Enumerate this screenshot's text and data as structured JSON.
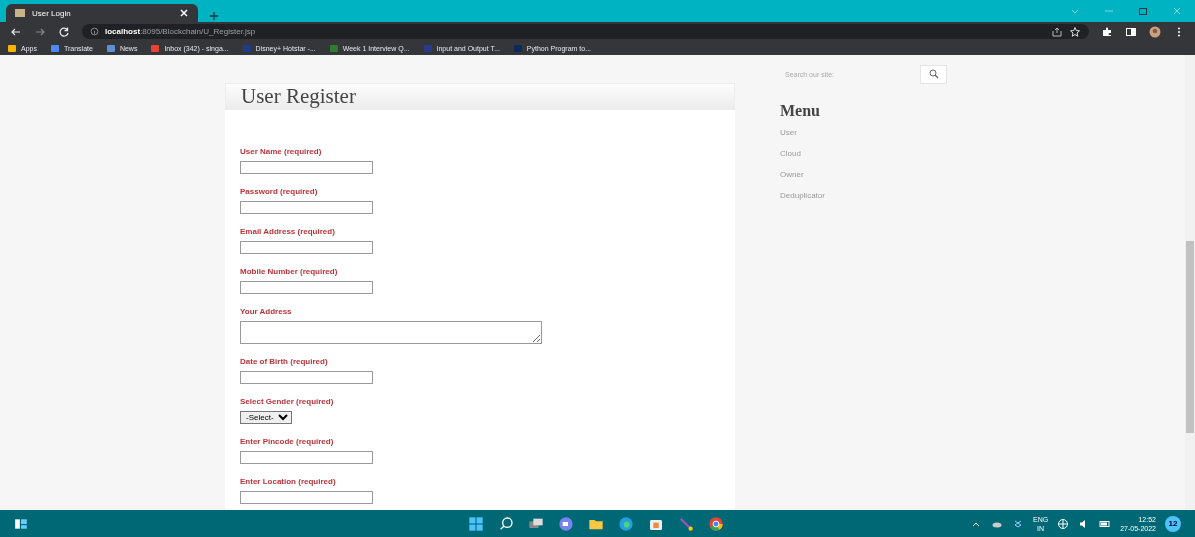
{
  "browser": {
    "tab": {
      "title": "User Login",
      "selected": true
    },
    "url": {
      "host": "localhost",
      "rest": ":8095/Blockchain/U_Register.jsp"
    },
    "bookmarks": [
      {
        "label": "Apps",
        "color": "#f4b400"
      },
      {
        "label": "Translate",
        "color": "#4a8af4"
      },
      {
        "label": "News",
        "color": "#5b8fd6"
      },
      {
        "label": "Inbox (342) - singa...",
        "color": "#ea4335"
      },
      {
        "label": "Disney+ Hotstar -...",
        "color": "#1f3c88"
      },
      {
        "label": "Week 1 Interview Q...",
        "color": "#2e7d32"
      },
      {
        "label": "Input and Output T...",
        "color": "#2b3a8c"
      },
      {
        "label": "Python Program to...",
        "color": "#0d2a5c"
      }
    ]
  },
  "page": {
    "heading": "User Register",
    "fields": [
      {
        "kind": "text",
        "label": "User Name (required)"
      },
      {
        "kind": "text",
        "label": "Password (required)"
      },
      {
        "kind": "text",
        "label": "Email Address (required)"
      },
      {
        "kind": "text",
        "label": "Mobile Number (required)"
      },
      {
        "kind": "textarea",
        "label": "Your Address"
      },
      {
        "kind": "text",
        "label": "Date of Birth (required)"
      },
      {
        "kind": "select",
        "label": "Select Gender (required)",
        "value": "-Select-"
      },
      {
        "kind": "text",
        "label": "Enter Pincode (required)"
      },
      {
        "kind": "text",
        "label": "Enter Location (required)"
      }
    ],
    "search": {
      "placeholder": "Search our site:"
    },
    "menu": {
      "title": "Menu",
      "items": [
        "User",
        "Cloud",
        "Owner",
        "Deduplicator"
      ]
    }
  },
  "taskbar": {
    "language": "ENG",
    "region": "IN",
    "time": "12:52",
    "date": "27-05-2022",
    "badge": "12"
  }
}
